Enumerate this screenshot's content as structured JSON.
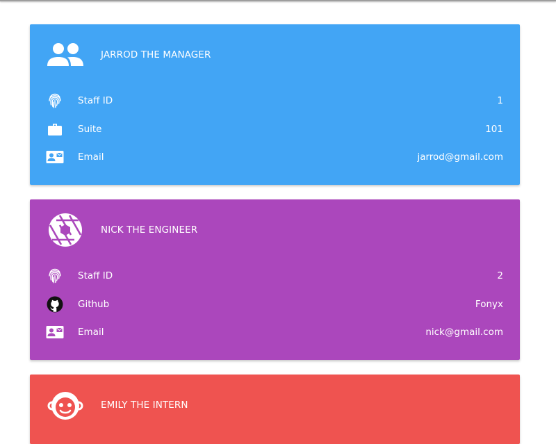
{
  "colors": {
    "manager": "#42a5f5",
    "engineer": "#ab47bc",
    "intern": "#ef5350"
  },
  "cards": [
    {
      "title": "JARROD THE MANAGER",
      "icon": "group-icon",
      "rows": [
        {
          "icon": "fingerprint-icon",
          "label": "Staff ID",
          "value": "1"
        },
        {
          "icon": "briefcase-icon",
          "label": "Suite",
          "value": "101"
        },
        {
          "icon": "contact-mail-icon",
          "label": "Email",
          "value": "jarrod@gmail.com"
        }
      ]
    },
    {
      "title": "NICK THE ENGINEER",
      "icon": "camera-shutter-icon",
      "rows": [
        {
          "icon": "fingerprint-icon",
          "label": "Staff ID",
          "value": "2"
        },
        {
          "icon": "github-icon",
          "label": "Github",
          "value": "Fonyx"
        },
        {
          "icon": "contact-mail-icon",
          "label": "Email",
          "value": "nick@gmail.com"
        }
      ]
    },
    {
      "title": "EMILY THE INTERN",
      "icon": "robot-face-icon",
      "rows": []
    }
  ]
}
